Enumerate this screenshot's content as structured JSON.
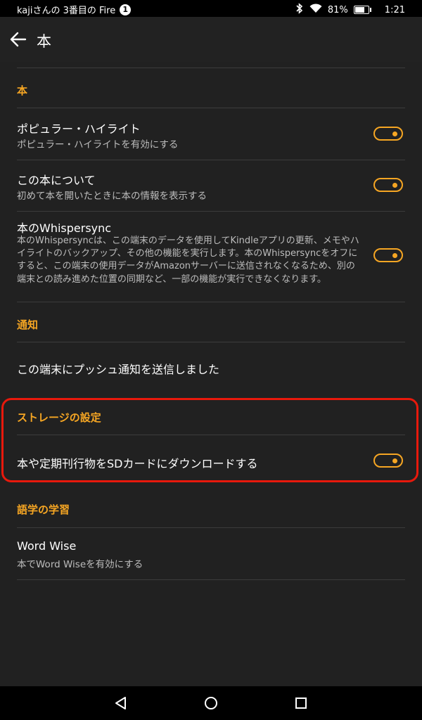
{
  "status_bar": {
    "device_name": "kajiさんの 3番目の Fire",
    "notification_count": "1",
    "battery_percent": "81%",
    "time": "1:21",
    "icons": [
      "bluetooth-icon",
      "wifi-icon",
      "battery-icon"
    ]
  },
  "app_bar": {
    "title": "本",
    "back_icon": "back-arrow-icon"
  },
  "sections": {
    "book": {
      "header": "本",
      "popular_highlights": {
        "title": "ポピュラー・ハイライト",
        "subtitle": "ポピュラー・ハイライトを有効にする",
        "enabled": true
      },
      "about_book": {
        "title": "この本について",
        "subtitle": "初めて本を開いたときに本の情報を表示する",
        "enabled": true
      },
      "whispersync": {
        "title": "本のWhispersync",
        "subtitle": "本のWhispersyncは、この端末のデータを使用してKindleアプリの更新、メモやハイライトのバックアップ、その他の機能を実行します。本のWhispersyncをオフにすると、この端末の使用データがAmazonサーバーに送信されなくなるため、別の端末との読み進めた位置の同期など、一部の機能が実行できなくなります。",
        "enabled": true
      }
    },
    "notifications": {
      "header": "通知",
      "push_sent": {
        "title": "この端末にプッシュ通知を送信しました"
      }
    },
    "storage": {
      "header": "ストレージの設定",
      "sd_download": {
        "title": "本や定期刊行物をSDカードにダウンロードする",
        "enabled": true
      }
    },
    "language_learning": {
      "header": "語学の学習",
      "word_wise": {
        "title": "Word Wise",
        "subtitle": "本でWord Wiseを有効にする"
      }
    }
  },
  "colors": {
    "accent": "#f6a623",
    "background": "#212121",
    "highlight_box": "#e8190c"
  },
  "nav_bar": {
    "icons": [
      "back-triangle-icon",
      "home-circle-icon",
      "recents-square-icon"
    ]
  }
}
